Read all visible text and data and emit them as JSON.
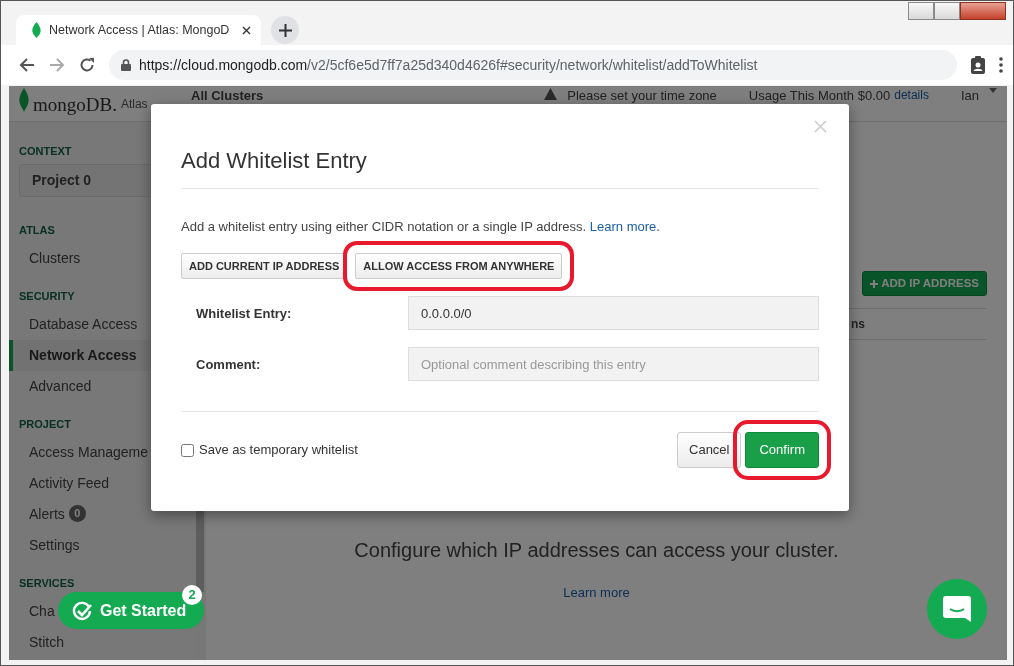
{
  "browser": {
    "tab_title": "Network Access | Atlas: MongoD",
    "url_host": "https://cloud.mongodb.com",
    "url_path": "/v2/5cf6e5d7ff7a25d340d4626f#security/network/whitelist/addToWhitelist"
  },
  "header": {
    "logo": "mongoDB.",
    "logo_suffix": "Atlas",
    "nav": "All Clusters",
    "warning": "Please set your time zone",
    "usage": "Usage This Month $0.00",
    "usage_link": "details",
    "user": "Ian"
  },
  "sidebar": {
    "context_heading": "CONTEXT",
    "project": "Project 0",
    "sections": [
      {
        "heading": "ATLAS",
        "items": [
          {
            "label": "Clusters",
            "selected": false
          }
        ]
      },
      {
        "heading": "SECURITY",
        "items": [
          {
            "label": "Database Access",
            "selected": false
          },
          {
            "label": "Network Access",
            "selected": true
          },
          {
            "label": "Advanced",
            "selected": false
          }
        ]
      },
      {
        "heading": "PROJECT",
        "items": [
          {
            "label": "Access Manageme",
            "selected": false
          },
          {
            "label": "Activity Feed",
            "selected": false
          },
          {
            "label": "Alerts",
            "selected": false,
            "badge": "0"
          },
          {
            "label": "Settings",
            "selected": false
          }
        ]
      },
      {
        "heading": "SERVICES",
        "items": [
          {
            "label": "Cha",
            "selected": false
          },
          {
            "label": "Stitch",
            "selected": false
          }
        ]
      }
    ]
  },
  "main": {
    "add_button": "ADD IP ADDRESS",
    "table": {
      "column_3": "ns"
    },
    "empty_message": "Configure which IP addresses can access your cluster.",
    "empty_link": "Learn more"
  },
  "modal": {
    "title": "Add Whitelist Entry",
    "description": "Add a whitelist entry using either CIDR notation or a single IP address.",
    "description_link": "Learn more",
    "description_end": ".",
    "quick_buttons": [
      {
        "label": "ADD CURRENT IP ADDRESS",
        "highlighted": false
      },
      {
        "label": "ALLOW ACCESS FROM ANYWHERE",
        "highlighted": true
      }
    ],
    "fields": [
      {
        "label": "Whitelist Entry:",
        "value": "0.0.0.0/0"
      },
      {
        "label": "Comment:",
        "placeholder": "Optional comment describing this entry"
      }
    ],
    "temporary": {
      "label": "Save as temporary whitelist",
      "checked": false
    },
    "cancel": {
      "label": "Cancel",
      "highlighted": false
    },
    "confirm": {
      "label": "Confirm",
      "highlighted": true
    }
  },
  "get_started": {
    "label": "Get Started",
    "count": "2"
  }
}
